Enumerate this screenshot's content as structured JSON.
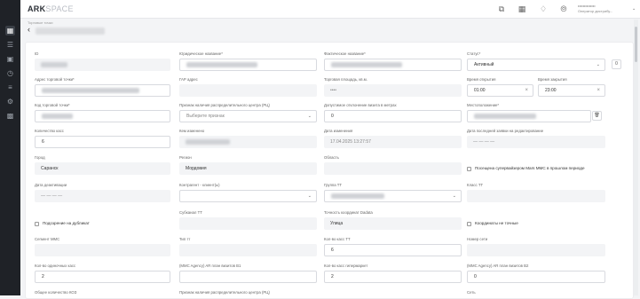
{
  "app": {
    "logo_main": "ARK",
    "logo_light": "SPACE"
  },
  "header": {
    "icons": [
      "copy-icon",
      "grid-icon",
      "bell-icon",
      "compass-icon"
    ],
    "user_name": "••••••••••••••",
    "user_role": "Оператор дистрибу..."
  },
  "breadcrumb": "Торговые точки",
  "sidebar": {
    "icons": [
      "home-icon",
      "list-icon",
      "document-icon",
      "clock-icon",
      "menu-icon",
      "settings-icon",
      "table-icon"
    ]
  },
  "form": {
    "id_label": "ID",
    "legal_name_label": "Юридическое название*",
    "actual_name_label": "Фактическое название*",
    "status_label": "Статус*",
    "status_value": "Активный",
    "status_extra": "0",
    "address_label": "Адрес торговой точки*",
    "fias_label": "ГАР адрес",
    "area_label": "Торговая площадь, кв.м.",
    "area_value": "••••",
    "open_time_label": "Время открытия",
    "open_time_value": "01:00",
    "close_time_label": "Время закрытия",
    "close_time_value": "23:00",
    "code_label": "Код торговой точки*",
    "dc_label": "Признак наличия распределительного центра (РЦ)",
    "dc_placeholder": "Выберите признак",
    "cashbox_label": "Допустимое отклонение визита в метрах",
    "cashbox_value": "0",
    "location_label": "Местоположение*",
    "registers_label": "Количество касс",
    "registers_value": "6",
    "modified_by_label": "Кем изменено",
    "modified_date_label": "Дата изменения",
    "modified_date_value": "17.04.2025 13:27:57",
    "last_order_label": "Дата последней заявки на редактирование",
    "last_order_value": "— — — —",
    "city_label": "Город",
    "city_value": "Саранск",
    "region_label": "Регион",
    "region_value": "Мордовия",
    "oblast_label": "Область",
    "supervisor_label": "Посещена супервайзером Mars MMC в прошлом периоде",
    "deactivation_label": "Дата деактивации",
    "deactivation_value": "— — — —",
    "contractor_label": "Контрагент - клиент(ы)",
    "group_label": "Группа ТТ",
    "class_label": "Класс ТТ",
    "duplicate_label": "Подозрение на дубликат",
    "subchannel_label": "Субканал ТТ",
    "dadata_label": "Точность координат Dadata",
    "dadata_value": "Улица",
    "coords_label": "Координаты не точные",
    "segment_label": "Сегмент ММС",
    "tt_type_label": "Тип тт",
    "cashbox_tt_label": "Кол-во касс ТТ",
    "cashbox_tt_value": "6",
    "network_label": "Номер сети",
    "one_cash_label": "Кол-во одиночных касс",
    "one_cash_value": "2",
    "mmc_b1_label": "(MMC Agency) AR план визитов В1",
    "mmc_b1_extra_label": "Кол-во касс гипермаркет",
    "mmc_b1_extra_value": "2",
    "mmc_b2_label": "(MMC Agency) AR план визитов В2",
    "mmc_b2_value": "0",
    "total_label": "Общее количество КОЗ",
    "dc2_label": "Признак наличия распределительного центра (РЦ)",
    "chain_label": "Сеть"
  }
}
